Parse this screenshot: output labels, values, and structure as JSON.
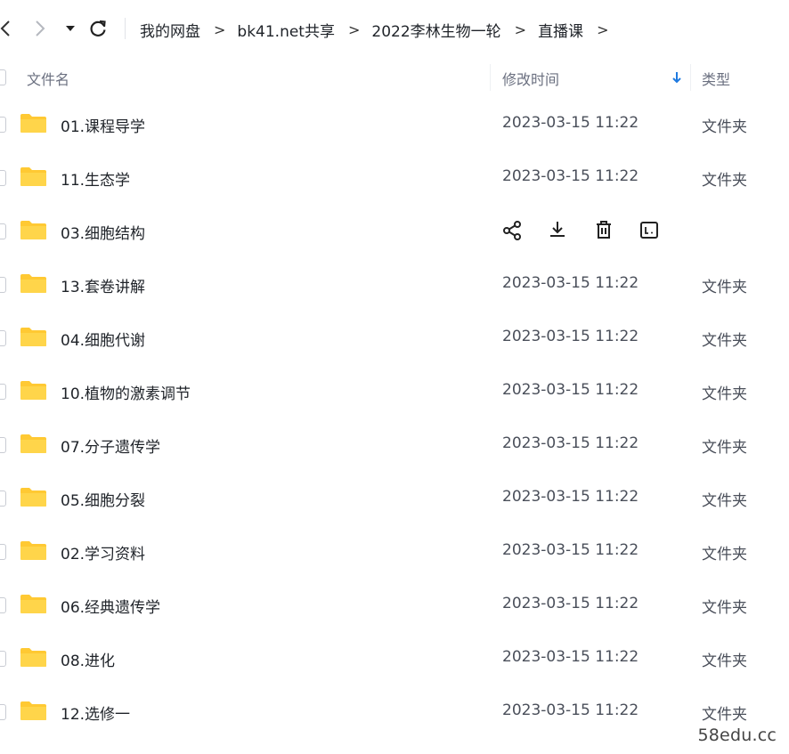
{
  "toolbar": {
    "back_icon": "chevron-left-icon",
    "forward_icon": "chevron-right-icon",
    "history_icon": "caret-down-icon",
    "refresh_icon": "refresh-icon"
  },
  "breadcrumb": {
    "items": [
      "我的网盘",
      "bk41.net共享",
      "2022李林生物一轮",
      "直播课"
    ],
    "separator": ">"
  },
  "columns": {
    "name": "文件名",
    "modified": "修改时间",
    "type": "类型",
    "sort_icon": "arrow-down-icon",
    "sort_color": "#1f7ae0"
  },
  "folder_color": "#ffc933",
  "rows": [
    {
      "name": "01.课程导学",
      "time": "2023-03-15 11:22",
      "type": "文件夹"
    },
    {
      "name": "11.生态学",
      "time": "2023-03-15 11:22",
      "type": "文件夹"
    },
    {
      "name": "03.细胞结构",
      "time": "",
      "type": ""
    },
    {
      "name": "13.套卷讲解",
      "time": "2023-03-15 11:22",
      "type": "文件夹"
    },
    {
      "name": "04.细胞代谢",
      "time": "2023-03-15 11:22",
      "type": "文件夹"
    },
    {
      "name": "10.植物的激素调节",
      "time": "2023-03-15 11:22",
      "type": "文件夹"
    },
    {
      "name": "07.分子遗传学",
      "time": "2023-03-15 11:22",
      "type": "文件夹"
    },
    {
      "name": "05.细胞分裂",
      "time": "2023-03-15 11:22",
      "type": "文件夹"
    },
    {
      "name": "02.学习资料",
      "time": "2023-03-15 11:22",
      "type": "文件夹"
    },
    {
      "name": "06.经典遗传学",
      "time": "2023-03-15 11:22",
      "type": "文件夹"
    },
    {
      "name": "08.进化",
      "time": "2023-03-15 11:22",
      "type": "文件夹"
    },
    {
      "name": "12.选修一",
      "time": "2023-03-15 11:22",
      "type": "文件夹"
    }
  ],
  "hover_actions": [
    "share-icon",
    "download-icon",
    "delete-icon",
    "rename-icon"
  ],
  "watermark": "58edu.cc"
}
